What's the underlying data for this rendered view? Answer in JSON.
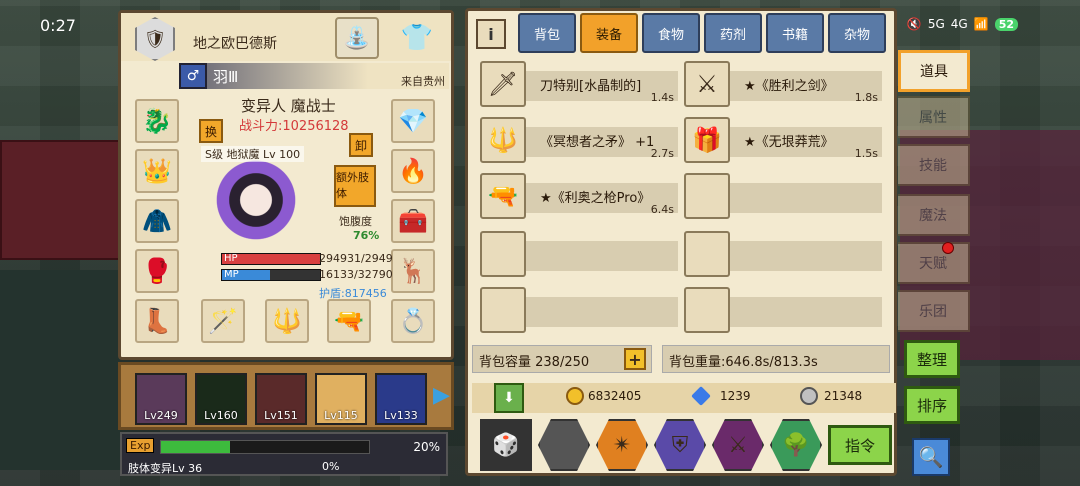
{
  "status_bar": {
    "time": "0:27",
    "signal1": "5G",
    "signal2": "4G",
    "battery": "52"
  },
  "left_panel": {
    "world": "地之欧巴德斯",
    "player_name": "羽Ⅲ",
    "origin": "来自贵州",
    "class_name": "变异人 魔战士",
    "power": "战斗力:10256128",
    "swap_label": "换",
    "unload_label": "卸",
    "extra_limb_label": "额外肢体",
    "level_tag": "S级 地狱魔 Lv 100",
    "hunger_label": "饱腹度",
    "hunger_value": "76%",
    "hp_label": "HP",
    "mp_label": "MP",
    "hp_value": "294931/2949",
    "mp_value": "16133/32790",
    "shield": "护盾:817456",
    "hp_ratio": 1.0,
    "mp_ratio": 0.49
  },
  "party": [
    {
      "label": "Lv249",
      "color": "#5a3a5a"
    },
    {
      "label": "Lv160",
      "color": "#1a2a1a"
    },
    {
      "label": "Lv151",
      "color": "#5a2a2a"
    },
    {
      "label": "Lv115",
      "color": "#e0b060"
    },
    {
      "label": "Lv133",
      "color": "#2a3a8a"
    }
  ],
  "exp": {
    "tag": "Exp",
    "percent": "20%",
    "ratio": 0.33,
    "mutation": "肢体变异Lv 36",
    "mutation_pct": "0%"
  },
  "inventory": {
    "tabs": [
      "背包",
      "装备",
      "食物",
      "药剂",
      "书籍",
      "杂物"
    ],
    "active_tab": 1,
    "items": [
      {
        "name": "刀特别[水晶制的]",
        "weight": "1.4s",
        "icon": "🗡"
      },
      {
        "name": "★《胜利之剑》",
        "weight": "1.8s",
        "icon": "⚔"
      },
      {
        "name": "《冥想者之矛》 +1",
        "weight": "2.7s",
        "icon": "🔱"
      },
      {
        "name": "★《无垠莽荒》",
        "weight": "1.5s",
        "icon": "🎁"
      },
      {
        "name": "★《利奥之枪Pro》",
        "weight": "6.4s",
        "icon": "🔫"
      },
      {
        "name": "",
        "weight": "",
        "icon": ""
      },
      {
        "name": "",
        "weight": "",
        "icon": ""
      },
      {
        "name": "",
        "weight": "",
        "icon": ""
      },
      {
        "name": "",
        "weight": "",
        "icon": ""
      },
      {
        "name": "",
        "weight": "",
        "icon": ""
      }
    ],
    "capacity": "背包容量 238/250",
    "weight": "背包重量:646.8s/813.3s",
    "gold": "6832405",
    "gems": "1239",
    "silver": "21348",
    "command_label": "指令"
  },
  "side_tabs": [
    "道具",
    "属性",
    "技能",
    "魔法",
    "天赋",
    "乐团"
  ],
  "side_buttons": {
    "arrange": "整理",
    "sort": "排序"
  }
}
